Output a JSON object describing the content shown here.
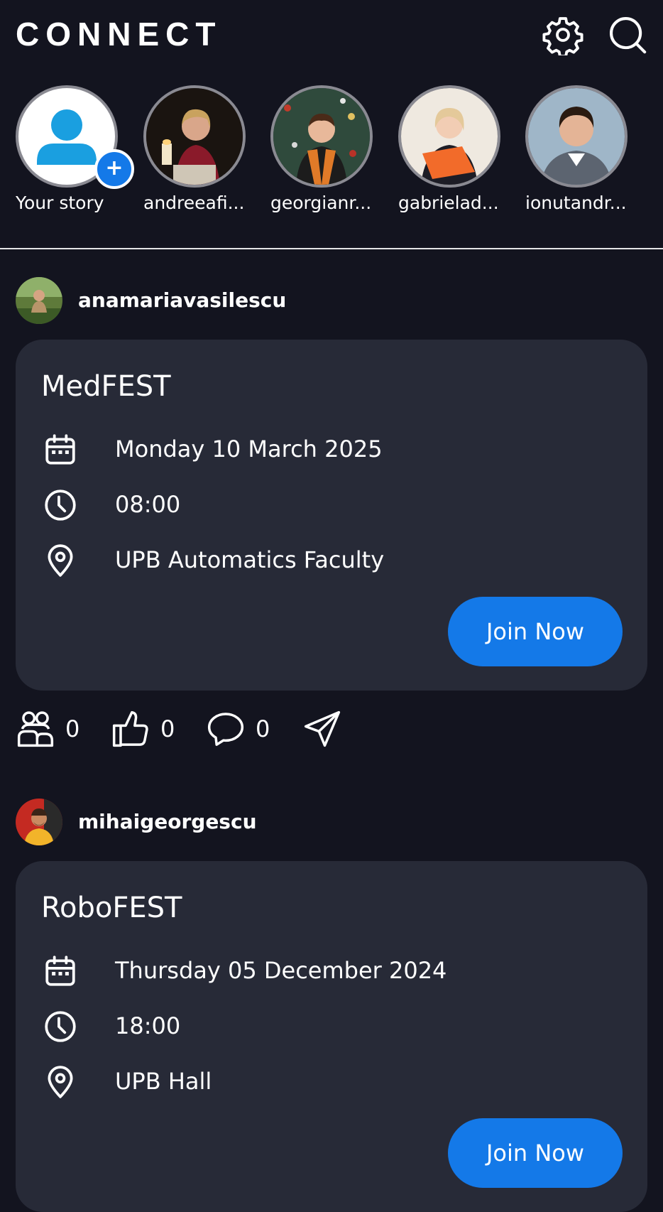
{
  "header": {
    "app_title": "CONNECT",
    "settings_icon": "gear-icon",
    "search_icon": "search-icon"
  },
  "stories": [
    {
      "label": "Your story",
      "is_own": true
    },
    {
      "label": "andreeafi..."
    },
    {
      "label": "georgianr..."
    },
    {
      "label": "gabrielad..."
    },
    {
      "label": "ionutandr..."
    }
  ],
  "posts": [
    {
      "author": "anamariavasilescu",
      "event": {
        "title": "MedFEST",
        "date": "Monday 10 March 2025",
        "time": "08:00",
        "location": "UPB Automatics Faculty",
        "join_label": "Join Now"
      },
      "stats": {
        "participants": "0",
        "likes": "0",
        "comments": "0"
      }
    },
    {
      "author": "mihaigeorgescu",
      "event": {
        "title": "RoboFEST",
        "date": "Thursday 05 December 2024",
        "time": "18:00",
        "location": "UPB Hall",
        "join_label": "Join Now"
      }
    }
  ],
  "colors": {
    "background": "#13141f",
    "card": "#272a37",
    "accent": "#1479e8",
    "text": "#ffffff"
  }
}
